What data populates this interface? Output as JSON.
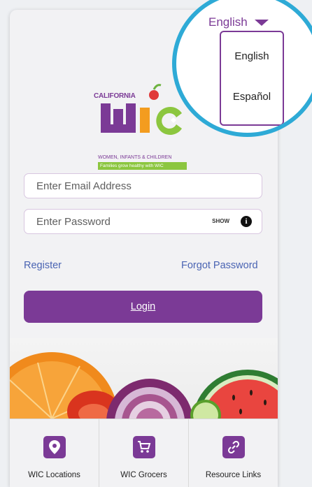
{
  "language": {
    "current": "English",
    "options": [
      "English",
      "Español"
    ]
  },
  "logo": {
    "state": "CALIFORNIA",
    "program": "WIC",
    "subtitle": "WOMEN, INFANTS & CHILDREN",
    "tagline": "Families grow healthy with WIC"
  },
  "form": {
    "email_placeholder": "Enter Email Address",
    "password_placeholder": "Enter Password",
    "show_label": "SHOW",
    "info_glyph": "i"
  },
  "links": {
    "register": "Register",
    "forgot": "Forgot Password"
  },
  "login_label": "Login",
  "bottom_nav": [
    {
      "label": "WIC Locations",
      "icon": "location-pin-icon"
    },
    {
      "label": "WIC Grocers",
      "icon": "shopping-cart-icon"
    },
    {
      "label": "Resource Links",
      "icon": "link-icon"
    }
  ],
  "colors": {
    "brand_purple": "#7b3a96",
    "link_blue": "#4a64b3",
    "wic_green": "#8cc63f",
    "magnifier_blue": "#2eaad6"
  }
}
